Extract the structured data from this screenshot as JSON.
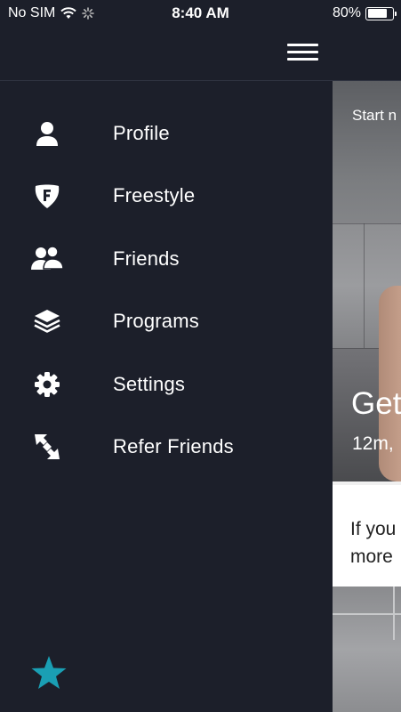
{
  "status_bar": {
    "carrier": "No SIM",
    "time": "8:40 AM",
    "battery_percent": "80%",
    "battery_level": 0.8,
    "icons": [
      "wifi-icon",
      "activity-spinner-icon",
      "battery-icon"
    ]
  },
  "header": {
    "menu_icon": "hamburger-icon"
  },
  "menu": {
    "items": [
      {
        "label": "Profile",
        "icon": "person-icon"
      },
      {
        "label": "Freestyle",
        "icon": "freestyle-badge-icon"
      },
      {
        "label": "Friends",
        "icon": "friends-icon"
      },
      {
        "label": "Programs",
        "icon": "layers-icon"
      },
      {
        "label": "Settings",
        "icon": "gear-icon"
      },
      {
        "label": "Refer Friends",
        "icon": "refer-arrows-icon"
      }
    ],
    "bottom_icon": "star-icon",
    "star_color": "#1a9fb4"
  },
  "content": {
    "hero_start": "Start n",
    "hero_title": "Get",
    "hero_meta": "12m,",
    "card_line1": "If you",
    "card_line2": "more"
  },
  "colors": {
    "background": "#1c1f2a",
    "accent": "#1a9fb4"
  }
}
